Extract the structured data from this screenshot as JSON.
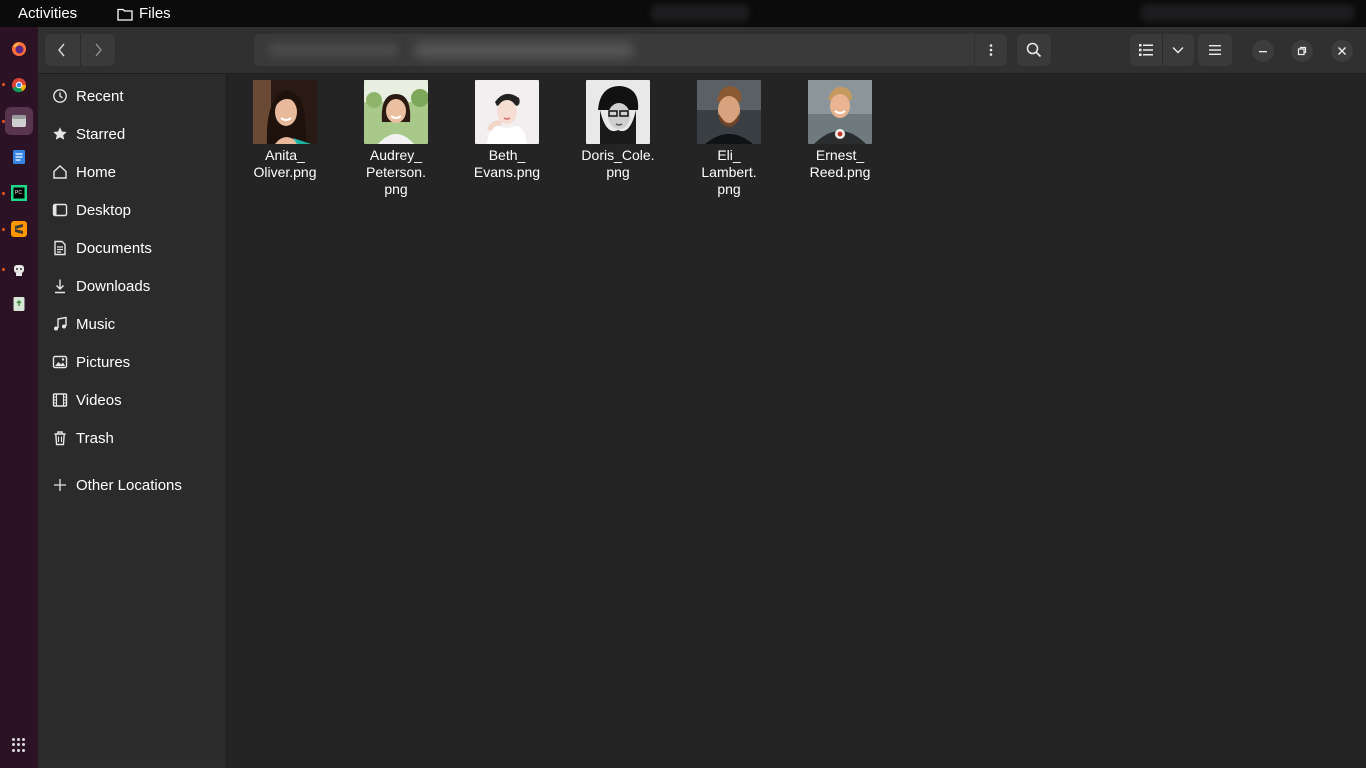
{
  "topbar": {
    "activities": "Activities",
    "app_name": "Files"
  },
  "sidebar": {
    "items": [
      {
        "label": "Recent",
        "icon": "clock-icon"
      },
      {
        "label": "Starred",
        "icon": "star-icon"
      },
      {
        "label": "Home",
        "icon": "home-icon"
      },
      {
        "label": "Desktop",
        "icon": "desktop-icon"
      },
      {
        "label": "Documents",
        "icon": "document-icon"
      },
      {
        "label": "Downloads",
        "icon": "download-icon"
      },
      {
        "label": "Music",
        "icon": "music-icon"
      },
      {
        "label": "Pictures",
        "icon": "picture-icon"
      },
      {
        "label": "Videos",
        "icon": "video-icon"
      },
      {
        "label": "Trash",
        "icon": "trash-icon"
      }
    ],
    "other_locations": "Other Locations"
  },
  "files": [
    {
      "name": "Anita_\nOliver.png",
      "thumb": "portrait-woman-dark-hair"
    },
    {
      "name": "Audrey_\nPeterson.\npng",
      "thumb": "portrait-woman-outdoors"
    },
    {
      "name": "Beth_\nEvans.png",
      "thumb": "portrait-woman-white-background"
    },
    {
      "name": "Doris_Cole.\npng",
      "thumb": "portrait-woman-beanie-grayscale"
    },
    {
      "name": "Eli_\nLambert.\npng",
      "thumb": "portrait-man-beard"
    },
    {
      "name": "Ernest_\nReed.png",
      "thumb": "portrait-man-smiling"
    }
  ],
  "colors": {
    "accent": "#e95420",
    "dock": "#2b1224",
    "sidebar": "#2b2b2b",
    "content": "#242424",
    "headerbar": "#303030"
  }
}
